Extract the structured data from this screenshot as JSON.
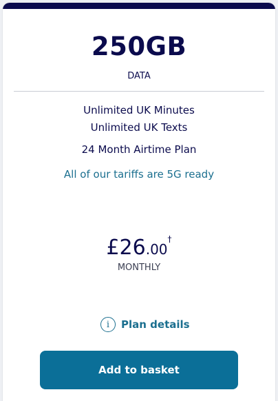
{
  "plan": {
    "data_amount": "250GB",
    "data_label": "DATA",
    "features": [
      "Unlimited UK Minutes",
      "Unlimited UK Texts",
      "24 Month Airtime Plan"
    ],
    "tariff_note": "All of our tariffs are 5G ready"
  },
  "price": {
    "main": "£26",
    "decimal": ".00",
    "footnote_mark": "†",
    "period": "MONTHLY"
  },
  "actions": {
    "plan_details_label": "Plan details",
    "add_to_basket_label": "Add to basket"
  },
  "icons": {
    "info": "info-icon"
  },
  "colors": {
    "brand_navy": "#0b0b4d",
    "accent_teal": "#1b6f8f",
    "button_blue": "#0b6f98"
  }
}
